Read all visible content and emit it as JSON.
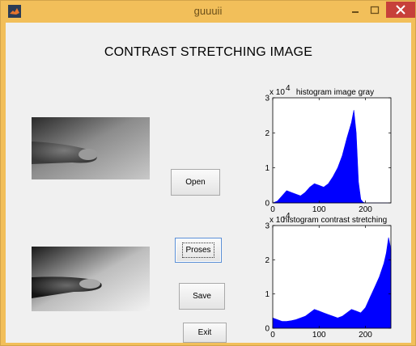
{
  "window": {
    "title": "guuuii",
    "accent_color": "#f2bf5a",
    "close_color": "#c7403a"
  },
  "main": {
    "title": "CONTRAST STRETCHING IMAGE",
    "buttons": {
      "open": "Open",
      "proses": "Proses",
      "save": "Save",
      "exit": "Exit"
    }
  },
  "chart_data": [
    {
      "type": "area",
      "title": "histogram image gray",
      "exponent_label": "x 10",
      "exponent_power": "4",
      "xlim": [
        0,
        255
      ],
      "ylim": [
        0,
        3
      ],
      "xticks": [
        0,
        100,
        200
      ],
      "xtick_labels": [
        "0",
        "100",
        "200"
      ],
      "yticks": [
        0,
        1,
        2,
        3
      ],
      "ytick_labels": [
        "0",
        "1",
        "2",
        "3"
      ],
      "color": "#0000ff",
      "x": [
        0,
        10,
        20,
        30,
        40,
        50,
        60,
        70,
        80,
        90,
        100,
        110,
        120,
        130,
        140,
        150,
        160,
        170,
        175,
        180,
        185,
        190,
        195,
        200,
        210,
        255
      ],
      "y": [
        0,
        0.05,
        0.2,
        0.35,
        0.3,
        0.25,
        0.2,
        0.3,
        0.45,
        0.55,
        0.5,
        0.45,
        0.55,
        0.75,
        1.0,
        1.35,
        1.85,
        2.3,
        2.65,
        2.0,
        0.6,
        0.1,
        0.02,
        0,
        0,
        0
      ]
    },
    {
      "type": "area",
      "title": "histogram contrast stretching",
      "exponent_label": "x 10",
      "exponent_power": "4",
      "xlim": [
        0,
        255
      ],
      "ylim": [
        0,
        3
      ],
      "xticks": [
        0,
        100,
        200
      ],
      "xtick_labels": [
        "0",
        "100",
        "200"
      ],
      "yticks": [
        0,
        1,
        2,
        3
      ],
      "ytick_labels": [
        "0",
        "1",
        "2",
        "3"
      ],
      "color": "#0000ff",
      "x": [
        0,
        10,
        20,
        30,
        40,
        50,
        60,
        70,
        80,
        90,
        100,
        110,
        120,
        130,
        140,
        150,
        160,
        170,
        180,
        190,
        200,
        210,
        220,
        230,
        240,
        245,
        250,
        255
      ],
      "y": [
        0.3,
        0.25,
        0.2,
        0.2,
        0.22,
        0.25,
        0.3,
        0.35,
        0.45,
        0.55,
        0.5,
        0.45,
        0.4,
        0.35,
        0.3,
        0.35,
        0.45,
        0.55,
        0.5,
        0.45,
        0.6,
        0.9,
        1.2,
        1.5,
        1.9,
        2.2,
        2.65,
        2.3
      ]
    }
  ]
}
